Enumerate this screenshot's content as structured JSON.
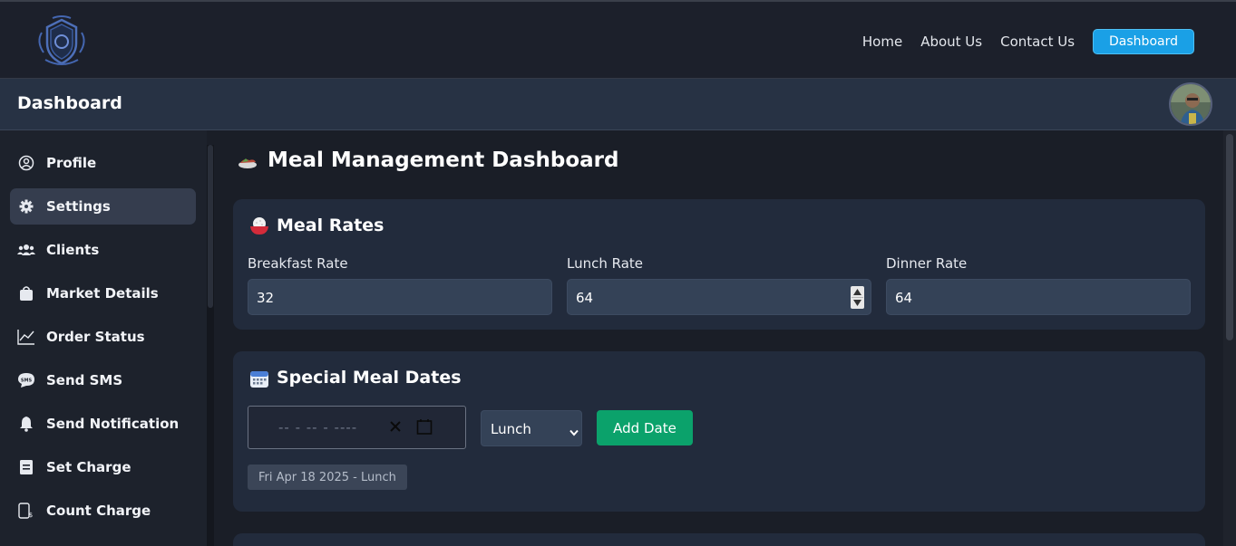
{
  "nav": {
    "links": [
      "Home",
      "About Us",
      "Contact Us"
    ],
    "button_label": "Dashboard",
    "logo_icon": "crest-shield-logo"
  },
  "header": {
    "title": "Dashboard",
    "avatar_icon": "user-avatar"
  },
  "sidebar": {
    "items": [
      {
        "label": "Profile",
        "icon": "user-circle-icon",
        "active": false
      },
      {
        "label": "Settings",
        "icon": "gear-icon",
        "active": true
      },
      {
        "label": "Clients",
        "icon": "users-icon",
        "active": false
      },
      {
        "label": "Market Details",
        "icon": "shopping-bag-icon",
        "active": false
      },
      {
        "label": "Order Status",
        "icon": "line-chart-icon",
        "active": false
      },
      {
        "label": "Send SMS",
        "icon": "sms-bubble-icon",
        "active": false
      },
      {
        "label": "Send Notification",
        "icon": "bell-icon",
        "active": false
      },
      {
        "label": "Set Charge",
        "icon": "receipt-icon",
        "active": false
      },
      {
        "label": "Count Charge",
        "icon": "phone-dollar-icon",
        "active": false
      }
    ]
  },
  "main": {
    "title": "Meal Management Dashboard",
    "title_icon": "meal-tray-icon",
    "meal_rates": {
      "title": "Meal Rates",
      "icon": "rice-bowl-icon",
      "fields": [
        {
          "label": "Breakfast Rate",
          "value": "32"
        },
        {
          "label": "Lunch Rate",
          "value": "64"
        },
        {
          "label": "Dinner Rate",
          "value": "64"
        }
      ]
    },
    "special_dates": {
      "title": "Special Meal Dates",
      "icon": "calendar-icon",
      "date_placeholder": "-- - -- - ----",
      "select_value": "Lunch",
      "add_button": "Add Date",
      "entries": [
        "Fri Apr 18 2025 - Lunch"
      ]
    }
  },
  "colors": {
    "accent": "#1aa0e6",
    "success": "#0ba26b",
    "card_bg": "#222b3c",
    "input_bg": "#344257"
  }
}
